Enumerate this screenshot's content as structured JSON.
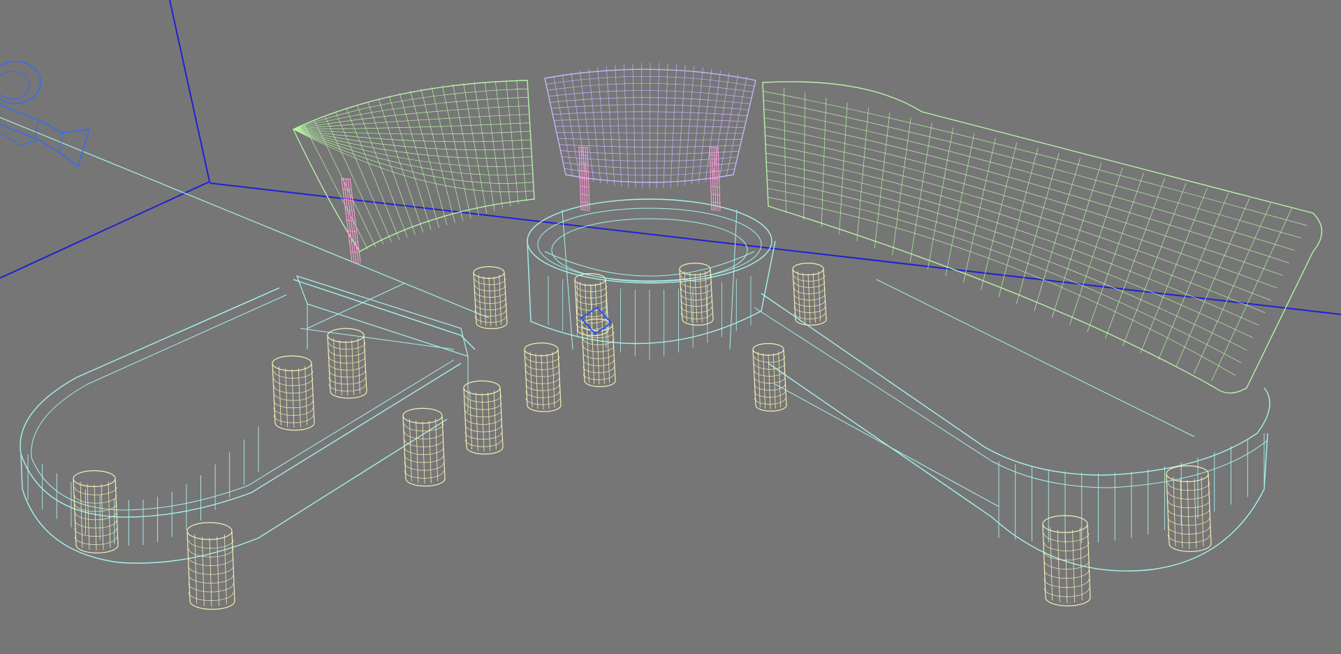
{
  "viewport": {
    "view": "perspective",
    "shading": "wireframe",
    "background_color": "#767676"
  },
  "colors": {
    "axis_blue": "#1f1fd6",
    "camera_blue": "#2d6bff",
    "selection_blue": "#2550ff",
    "cyan_seat": "#a7f4f0",
    "green_backrest": "#b7f5a7",
    "purple_backrest": "#c9b3ff",
    "pink_pole": "#ff9dd6",
    "yellow_leg": "#f5f0b8"
  },
  "scene_objects": [
    {
      "name": "curved-sofa-base",
      "color_key": "cyan_seat",
      "mesh": "wireframe"
    },
    {
      "name": "left-backrest",
      "color_key": "green_backrest",
      "mesh": "wireframe"
    },
    {
      "name": "center-backrest",
      "color_key": "purple_backrest",
      "mesh": "wireframe"
    },
    {
      "name": "right-backrest",
      "color_key": "green_backrest",
      "mesh": "wireframe"
    },
    {
      "name": "support-poles",
      "color_key": "pink_pole",
      "mesh": "wireframe"
    },
    {
      "name": "sofa-legs",
      "color_key": "yellow_leg",
      "mesh": "wireframe"
    },
    {
      "name": "scene-camera",
      "color_key": "camera_blue",
      "mesh": "wireframe"
    },
    {
      "name": "selected-manipulator",
      "color_key": "selection_blue",
      "mesh": "wireframe"
    }
  ]
}
